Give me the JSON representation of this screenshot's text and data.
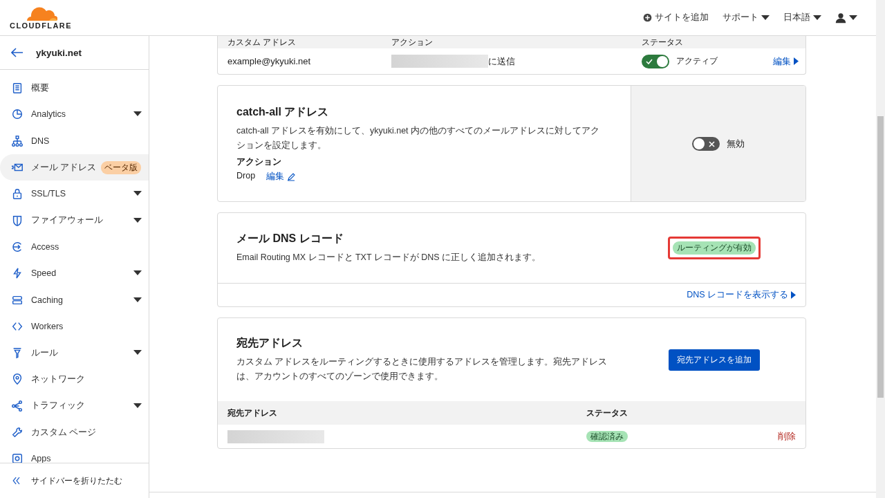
{
  "topbar": {
    "logo": "CLOUDFLARE",
    "nav": [
      {
        "kind": "add",
        "label": "サイトを追加"
      },
      {
        "kind": "menu",
        "label": "サポート"
      },
      {
        "kind": "menu",
        "label": "日本語"
      },
      {
        "kind": "user"
      }
    ]
  },
  "sidebar": {
    "zone": "ykyuki.net",
    "items": [
      {
        "label": "概要",
        "expandable": false,
        "selected": false
      },
      {
        "label": "Analytics",
        "expandable": true,
        "selected": false
      },
      {
        "label": "DNS",
        "expandable": false,
        "selected": false
      },
      {
        "label": "メール アドレス",
        "expandable": false,
        "selected": true,
        "badge": "ベータ版"
      },
      {
        "label": "SSL/TLS",
        "expandable": true,
        "selected": false
      },
      {
        "label": "ファイアウォール",
        "expandable": true,
        "selected": false
      },
      {
        "label": "Access",
        "expandable": false,
        "selected": false
      },
      {
        "label": "Speed",
        "expandable": true,
        "selected": false
      },
      {
        "label": "Caching",
        "expandable": true,
        "selected": false
      },
      {
        "label": "Workers",
        "expandable": false,
        "selected": false
      },
      {
        "label": "ルール",
        "expandable": true,
        "selected": false
      },
      {
        "label": "ネットワーク",
        "expandable": false,
        "selected": false
      },
      {
        "label": "トラフィック",
        "expandable": true,
        "selected": false
      },
      {
        "label": "カスタム ページ",
        "expandable": false,
        "selected": false
      },
      {
        "label": "Apps",
        "expandable": false,
        "selected": false
      }
    ],
    "collapse": "サイドバーを折りたたむ"
  },
  "routes_table": {
    "columns": [
      "カスタム アドレス",
      "アクション",
      "ステータス"
    ],
    "rows": [
      {
        "address": "example@ykyuki.net",
        "action": "に送信",
        "on": true,
        "status": "アクティブ",
        "edit": "編集"
      }
    ]
  },
  "catch_all": {
    "title": "catch-all アドレス",
    "description": "catch-all アドレスを有効にして、ykyuki.net 内の他のすべてのメールアドレスに対してアクションを設定します。",
    "action_label": "アクション",
    "action_value": "Drop",
    "edit": "編集",
    "on": false,
    "status": "無効"
  },
  "dns_records": {
    "title": "メール DNS レコード",
    "description": "Email Routing MX レコードと TXT レコードが DNS に正しく追加されます。",
    "badge": "ルーティングが有効",
    "highlighted": true,
    "link": "DNS レコードを表示する"
  },
  "destinations": {
    "title": "宛先アドレス",
    "description": "カスタム アドレスをルーティングするときに使用するアドレスを管理します。宛先アドレスは、アカウントのすべてのゾーンで使用できます。",
    "button": "宛先アドレスを追加",
    "columns": [
      "宛先アドレス",
      "ステータス"
    ],
    "rows": [
      {
        "status": "確認済み",
        "delete": "削除"
      }
    ]
  }
}
